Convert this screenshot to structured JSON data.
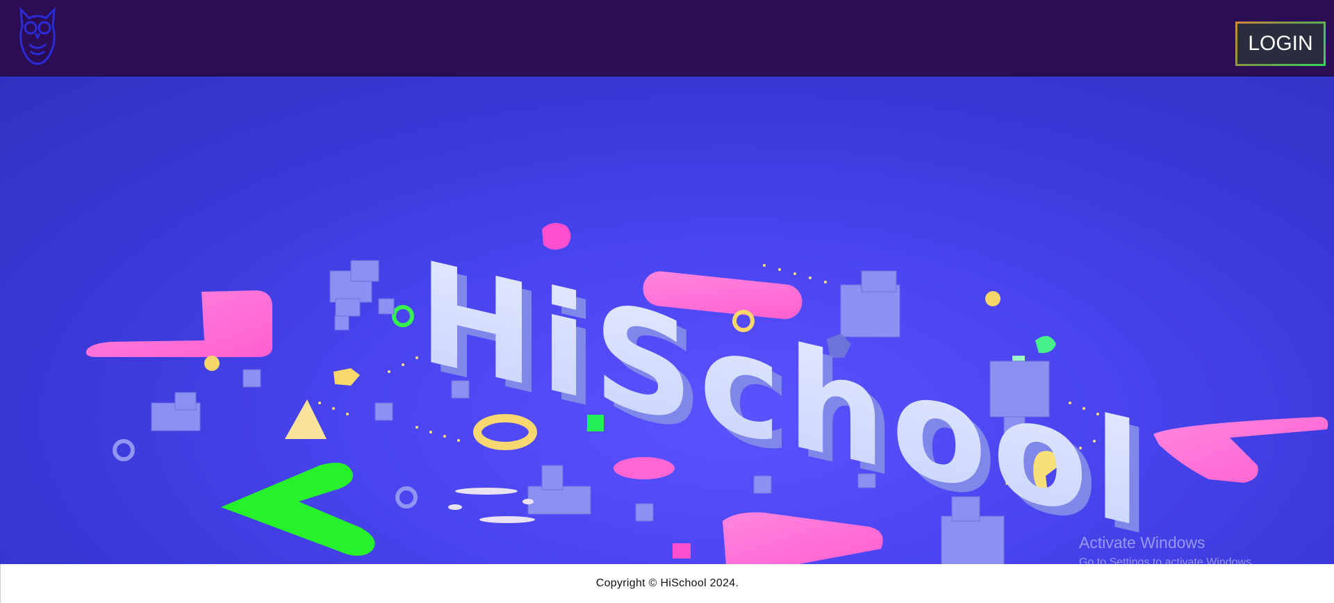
{
  "header": {
    "logo_icon": "owl-icon",
    "login_label": "LOGIN"
  },
  "hero": {
    "title": "HiSchool"
  },
  "watermark": {
    "line1": "Activate Windows",
    "line2": "Go to Settings to activate Windows."
  },
  "footer": {
    "copyright": "Copyright © HiSchool 2024."
  },
  "colors": {
    "navbar": "#2a0d52",
    "hero_blue": "#4a45f0",
    "pink": "#ff6fd8",
    "green": "#28f028",
    "yellow": "#f6dd7a"
  }
}
